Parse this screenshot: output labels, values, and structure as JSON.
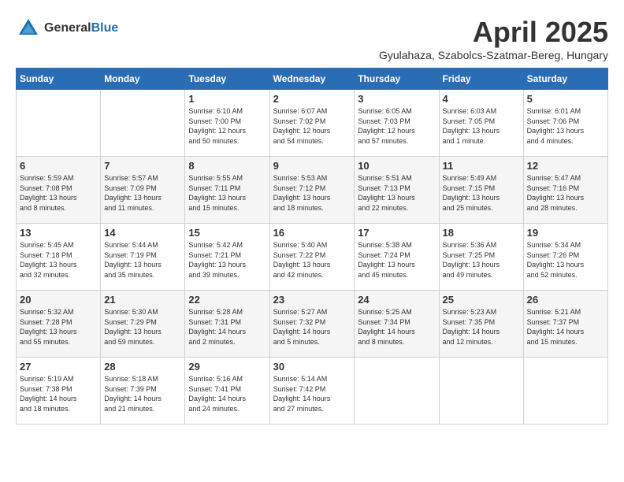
{
  "logo": {
    "text_general": "General",
    "text_blue": "Blue"
  },
  "header": {
    "month_year": "April 2025",
    "location": "Gyulahaza, Szabolcs-Szatmar-Bereg, Hungary"
  },
  "weekdays": [
    "Sunday",
    "Monday",
    "Tuesday",
    "Wednesday",
    "Thursday",
    "Friday",
    "Saturday"
  ],
  "weeks": [
    {
      "days": [
        {
          "num": "",
          "info": ""
        },
        {
          "num": "",
          "info": ""
        },
        {
          "num": "1",
          "info": "Sunrise: 6:10 AM\nSunset: 7:00 PM\nDaylight: 12 hours\nand 50 minutes."
        },
        {
          "num": "2",
          "info": "Sunrise: 6:07 AM\nSunset: 7:02 PM\nDaylight: 12 hours\nand 54 minutes."
        },
        {
          "num": "3",
          "info": "Sunrise: 6:05 AM\nSunset: 7:03 PM\nDaylight: 12 hours\nand 57 minutes."
        },
        {
          "num": "4",
          "info": "Sunrise: 6:03 AM\nSunset: 7:05 PM\nDaylight: 13 hours\nand 1 minute."
        },
        {
          "num": "5",
          "info": "Sunrise: 6:01 AM\nSunset: 7:06 PM\nDaylight: 13 hours\nand 4 minutes."
        }
      ]
    },
    {
      "days": [
        {
          "num": "6",
          "info": "Sunrise: 5:59 AM\nSunset: 7:08 PM\nDaylight: 13 hours\nand 8 minutes."
        },
        {
          "num": "7",
          "info": "Sunrise: 5:57 AM\nSunset: 7:09 PM\nDaylight: 13 hours\nand 11 minutes."
        },
        {
          "num": "8",
          "info": "Sunrise: 5:55 AM\nSunset: 7:11 PM\nDaylight: 13 hours\nand 15 minutes."
        },
        {
          "num": "9",
          "info": "Sunrise: 5:53 AM\nSunset: 7:12 PM\nDaylight: 13 hours\nand 18 minutes."
        },
        {
          "num": "10",
          "info": "Sunrise: 5:51 AM\nSunset: 7:13 PM\nDaylight: 13 hours\nand 22 minutes."
        },
        {
          "num": "11",
          "info": "Sunrise: 5:49 AM\nSunset: 7:15 PM\nDaylight: 13 hours\nand 25 minutes."
        },
        {
          "num": "12",
          "info": "Sunrise: 5:47 AM\nSunset: 7:16 PM\nDaylight: 13 hours\nand 28 minutes."
        }
      ]
    },
    {
      "days": [
        {
          "num": "13",
          "info": "Sunrise: 5:45 AM\nSunset: 7:18 PM\nDaylight: 13 hours\nand 32 minutes."
        },
        {
          "num": "14",
          "info": "Sunrise: 5:44 AM\nSunset: 7:19 PM\nDaylight: 13 hours\nand 35 minutes."
        },
        {
          "num": "15",
          "info": "Sunrise: 5:42 AM\nSunset: 7:21 PM\nDaylight: 13 hours\nand 39 minutes."
        },
        {
          "num": "16",
          "info": "Sunrise: 5:40 AM\nSunset: 7:22 PM\nDaylight: 13 hours\nand 42 minutes."
        },
        {
          "num": "17",
          "info": "Sunrise: 5:38 AM\nSunset: 7:24 PM\nDaylight: 13 hours\nand 45 minutes."
        },
        {
          "num": "18",
          "info": "Sunrise: 5:36 AM\nSunset: 7:25 PM\nDaylight: 13 hours\nand 49 minutes."
        },
        {
          "num": "19",
          "info": "Sunrise: 5:34 AM\nSunset: 7:26 PM\nDaylight: 13 hours\nand 52 minutes."
        }
      ]
    },
    {
      "days": [
        {
          "num": "20",
          "info": "Sunrise: 5:32 AM\nSunset: 7:28 PM\nDaylight: 13 hours\nand 55 minutes."
        },
        {
          "num": "21",
          "info": "Sunrise: 5:30 AM\nSunset: 7:29 PM\nDaylight: 13 hours\nand 59 minutes."
        },
        {
          "num": "22",
          "info": "Sunrise: 5:28 AM\nSunset: 7:31 PM\nDaylight: 14 hours\nand 2 minutes."
        },
        {
          "num": "23",
          "info": "Sunrise: 5:27 AM\nSunset: 7:32 PM\nDaylight: 14 hours\nand 5 minutes."
        },
        {
          "num": "24",
          "info": "Sunrise: 5:25 AM\nSunset: 7:34 PM\nDaylight: 14 hours\nand 8 minutes."
        },
        {
          "num": "25",
          "info": "Sunrise: 5:23 AM\nSunset: 7:35 PM\nDaylight: 14 hours\nand 12 minutes."
        },
        {
          "num": "26",
          "info": "Sunrise: 5:21 AM\nSunset: 7:37 PM\nDaylight: 14 hours\nand 15 minutes."
        }
      ]
    },
    {
      "days": [
        {
          "num": "27",
          "info": "Sunrise: 5:19 AM\nSunset: 7:38 PM\nDaylight: 14 hours\nand 18 minutes."
        },
        {
          "num": "28",
          "info": "Sunrise: 5:18 AM\nSunset: 7:39 PM\nDaylight: 14 hours\nand 21 minutes."
        },
        {
          "num": "29",
          "info": "Sunrise: 5:16 AM\nSunset: 7:41 PM\nDaylight: 14 hours\nand 24 minutes."
        },
        {
          "num": "30",
          "info": "Sunrise: 5:14 AM\nSunset: 7:42 PM\nDaylight: 14 hours\nand 27 minutes."
        },
        {
          "num": "",
          "info": ""
        },
        {
          "num": "",
          "info": ""
        },
        {
          "num": "",
          "info": ""
        }
      ]
    }
  ]
}
